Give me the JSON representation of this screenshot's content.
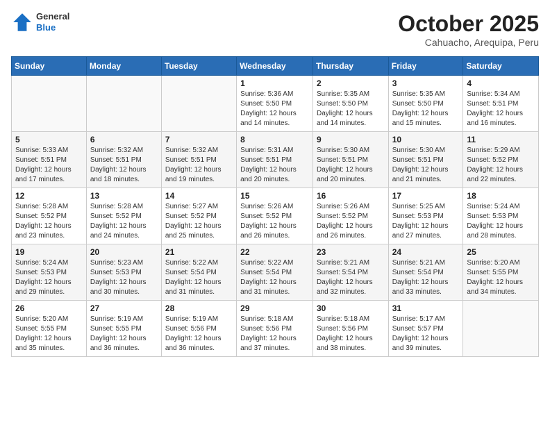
{
  "header": {
    "logo": {
      "general": "General",
      "blue": "Blue"
    },
    "title": "October 2025",
    "location": "Cahuacho, Arequipa, Peru"
  },
  "days_of_week": [
    "Sunday",
    "Monday",
    "Tuesday",
    "Wednesday",
    "Thursday",
    "Friday",
    "Saturday"
  ],
  "weeks": [
    [
      {
        "day": "",
        "info": ""
      },
      {
        "day": "",
        "info": ""
      },
      {
        "day": "",
        "info": ""
      },
      {
        "day": "1",
        "info": "Sunrise: 5:36 AM\nSunset: 5:50 PM\nDaylight: 12 hours\nand 14 minutes."
      },
      {
        "day": "2",
        "info": "Sunrise: 5:35 AM\nSunset: 5:50 PM\nDaylight: 12 hours\nand 14 minutes."
      },
      {
        "day": "3",
        "info": "Sunrise: 5:35 AM\nSunset: 5:50 PM\nDaylight: 12 hours\nand 15 minutes."
      },
      {
        "day": "4",
        "info": "Sunrise: 5:34 AM\nSunset: 5:51 PM\nDaylight: 12 hours\nand 16 minutes."
      }
    ],
    [
      {
        "day": "5",
        "info": "Sunrise: 5:33 AM\nSunset: 5:51 PM\nDaylight: 12 hours\nand 17 minutes."
      },
      {
        "day": "6",
        "info": "Sunrise: 5:32 AM\nSunset: 5:51 PM\nDaylight: 12 hours\nand 18 minutes."
      },
      {
        "day": "7",
        "info": "Sunrise: 5:32 AM\nSunset: 5:51 PM\nDaylight: 12 hours\nand 19 minutes."
      },
      {
        "day": "8",
        "info": "Sunrise: 5:31 AM\nSunset: 5:51 PM\nDaylight: 12 hours\nand 20 minutes."
      },
      {
        "day": "9",
        "info": "Sunrise: 5:30 AM\nSunset: 5:51 PM\nDaylight: 12 hours\nand 20 minutes."
      },
      {
        "day": "10",
        "info": "Sunrise: 5:30 AM\nSunset: 5:51 PM\nDaylight: 12 hours\nand 21 minutes."
      },
      {
        "day": "11",
        "info": "Sunrise: 5:29 AM\nSunset: 5:52 PM\nDaylight: 12 hours\nand 22 minutes."
      }
    ],
    [
      {
        "day": "12",
        "info": "Sunrise: 5:28 AM\nSunset: 5:52 PM\nDaylight: 12 hours\nand 23 minutes."
      },
      {
        "day": "13",
        "info": "Sunrise: 5:28 AM\nSunset: 5:52 PM\nDaylight: 12 hours\nand 24 minutes."
      },
      {
        "day": "14",
        "info": "Sunrise: 5:27 AM\nSunset: 5:52 PM\nDaylight: 12 hours\nand 25 minutes."
      },
      {
        "day": "15",
        "info": "Sunrise: 5:26 AM\nSunset: 5:52 PM\nDaylight: 12 hours\nand 26 minutes."
      },
      {
        "day": "16",
        "info": "Sunrise: 5:26 AM\nSunset: 5:52 PM\nDaylight: 12 hours\nand 26 minutes."
      },
      {
        "day": "17",
        "info": "Sunrise: 5:25 AM\nSunset: 5:53 PM\nDaylight: 12 hours\nand 27 minutes."
      },
      {
        "day": "18",
        "info": "Sunrise: 5:24 AM\nSunset: 5:53 PM\nDaylight: 12 hours\nand 28 minutes."
      }
    ],
    [
      {
        "day": "19",
        "info": "Sunrise: 5:24 AM\nSunset: 5:53 PM\nDaylight: 12 hours\nand 29 minutes."
      },
      {
        "day": "20",
        "info": "Sunrise: 5:23 AM\nSunset: 5:53 PM\nDaylight: 12 hours\nand 30 minutes."
      },
      {
        "day": "21",
        "info": "Sunrise: 5:22 AM\nSunset: 5:54 PM\nDaylight: 12 hours\nand 31 minutes."
      },
      {
        "day": "22",
        "info": "Sunrise: 5:22 AM\nSunset: 5:54 PM\nDaylight: 12 hours\nand 31 minutes."
      },
      {
        "day": "23",
        "info": "Sunrise: 5:21 AM\nSunset: 5:54 PM\nDaylight: 12 hours\nand 32 minutes."
      },
      {
        "day": "24",
        "info": "Sunrise: 5:21 AM\nSunset: 5:54 PM\nDaylight: 12 hours\nand 33 minutes."
      },
      {
        "day": "25",
        "info": "Sunrise: 5:20 AM\nSunset: 5:55 PM\nDaylight: 12 hours\nand 34 minutes."
      }
    ],
    [
      {
        "day": "26",
        "info": "Sunrise: 5:20 AM\nSunset: 5:55 PM\nDaylight: 12 hours\nand 35 minutes."
      },
      {
        "day": "27",
        "info": "Sunrise: 5:19 AM\nSunset: 5:55 PM\nDaylight: 12 hours\nand 36 minutes."
      },
      {
        "day": "28",
        "info": "Sunrise: 5:19 AM\nSunset: 5:56 PM\nDaylight: 12 hours\nand 36 minutes."
      },
      {
        "day": "29",
        "info": "Sunrise: 5:18 AM\nSunset: 5:56 PM\nDaylight: 12 hours\nand 37 minutes."
      },
      {
        "day": "30",
        "info": "Sunrise: 5:18 AM\nSunset: 5:56 PM\nDaylight: 12 hours\nand 38 minutes."
      },
      {
        "day": "31",
        "info": "Sunrise: 5:17 AM\nSunset: 5:57 PM\nDaylight: 12 hours\nand 39 minutes."
      },
      {
        "day": "",
        "info": ""
      }
    ]
  ]
}
